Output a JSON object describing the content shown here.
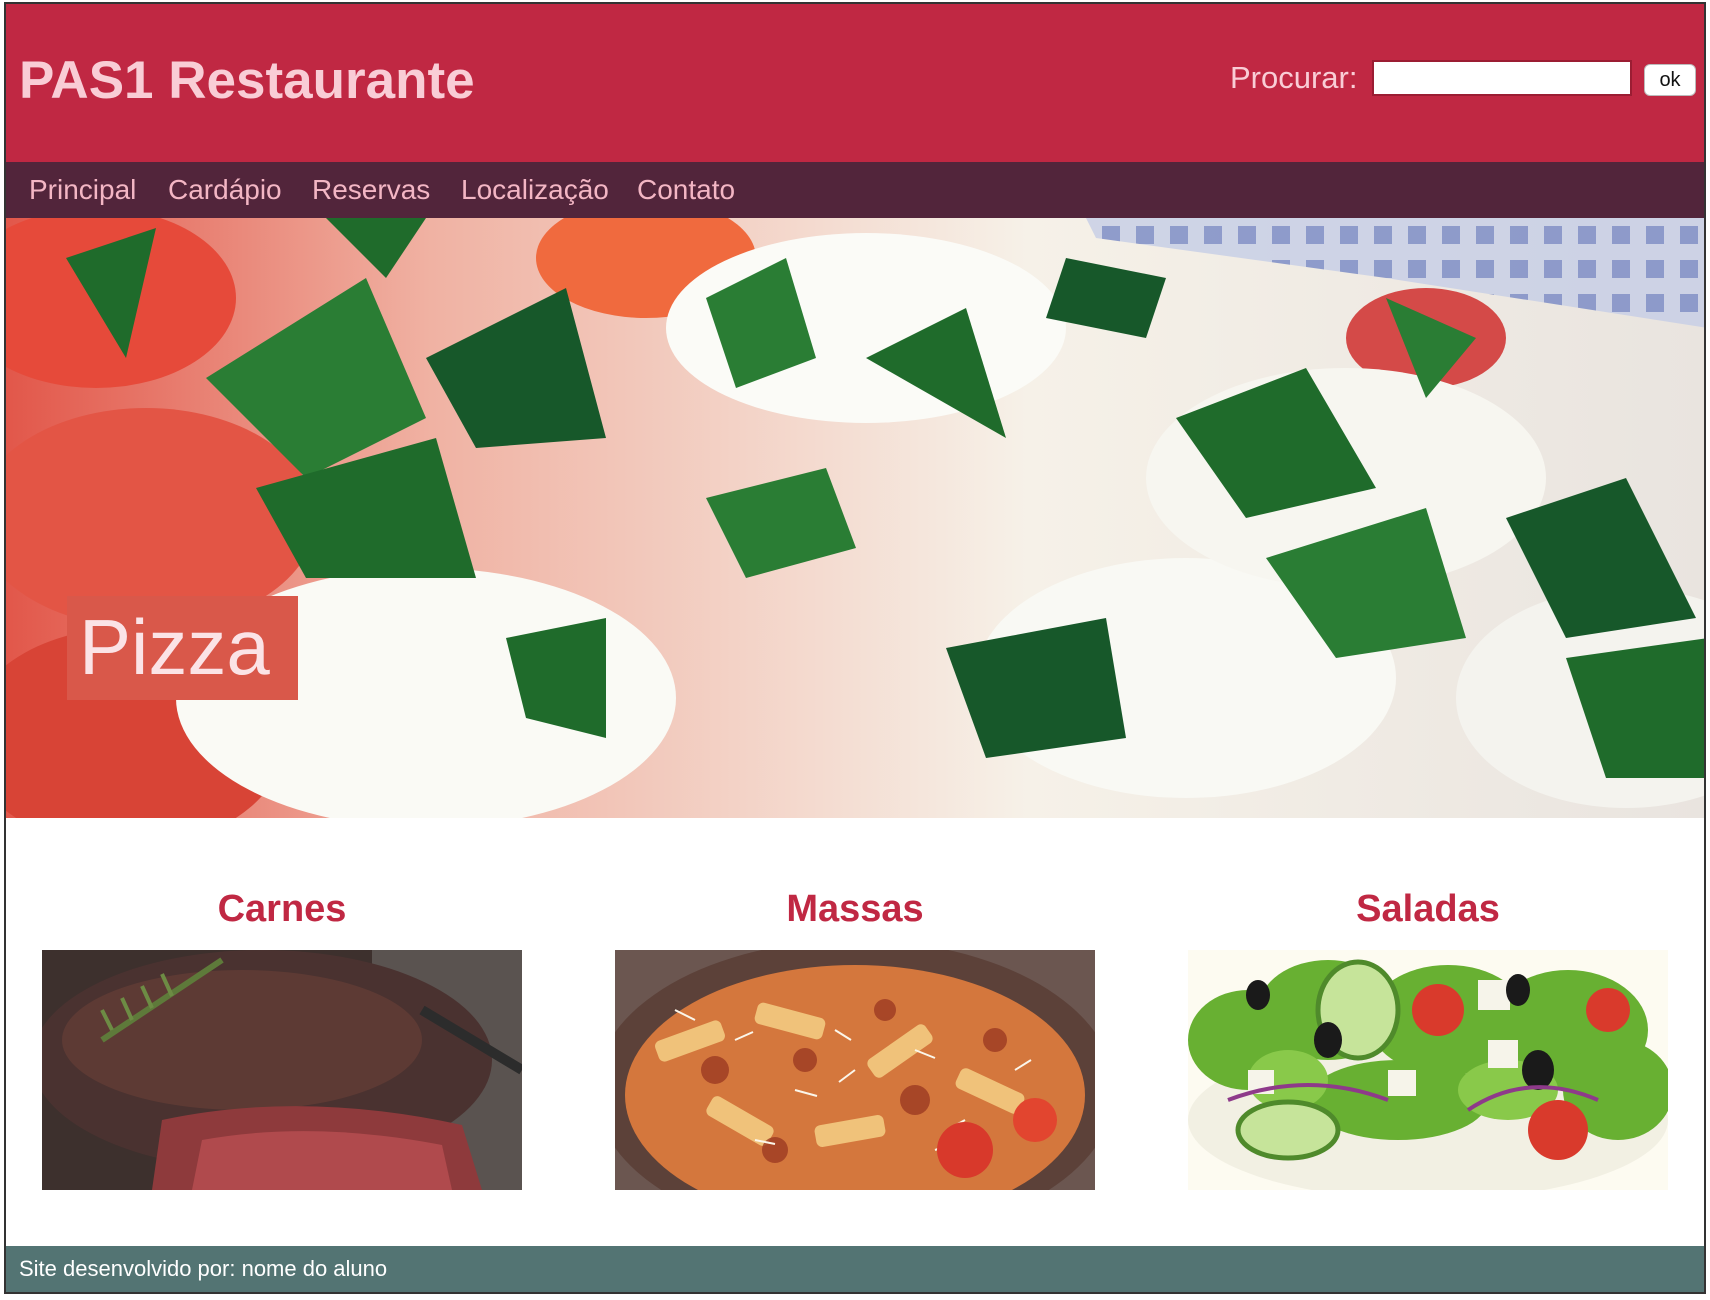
{
  "header": {
    "site_title": "PAS1 Restaurante",
    "search_label": "Procurar:",
    "search_value": "",
    "search_button_label": "ok"
  },
  "nav": {
    "items": [
      {
        "label": "Principal"
      },
      {
        "label": "Cardápio"
      },
      {
        "label": "Reservas"
      },
      {
        "label": "Localização"
      },
      {
        "label": "Contato"
      }
    ]
  },
  "hero": {
    "caption": "Pizza",
    "image_subject": "mozzarella, basil and tomato close-up"
  },
  "categories": [
    {
      "title": "Carnes",
      "image_subject": "grilled steak with rosemary"
    },
    {
      "title": "Massas",
      "image_subject": "penne bolognese with parmesan"
    },
    {
      "title": "Saladas",
      "image_subject": "greek salad with olives and feta"
    }
  ],
  "footer": {
    "text": "Site desenvolvido por: nome do aluno"
  },
  "colors": {
    "header_bg": "#c02843",
    "header_text": "#f9cdd6",
    "nav_bg": "#52253b",
    "nav_text": "#f3b6c4",
    "badge_bg": "#d9584a",
    "category_title": "#c02843",
    "footer_bg": "#537473"
  }
}
